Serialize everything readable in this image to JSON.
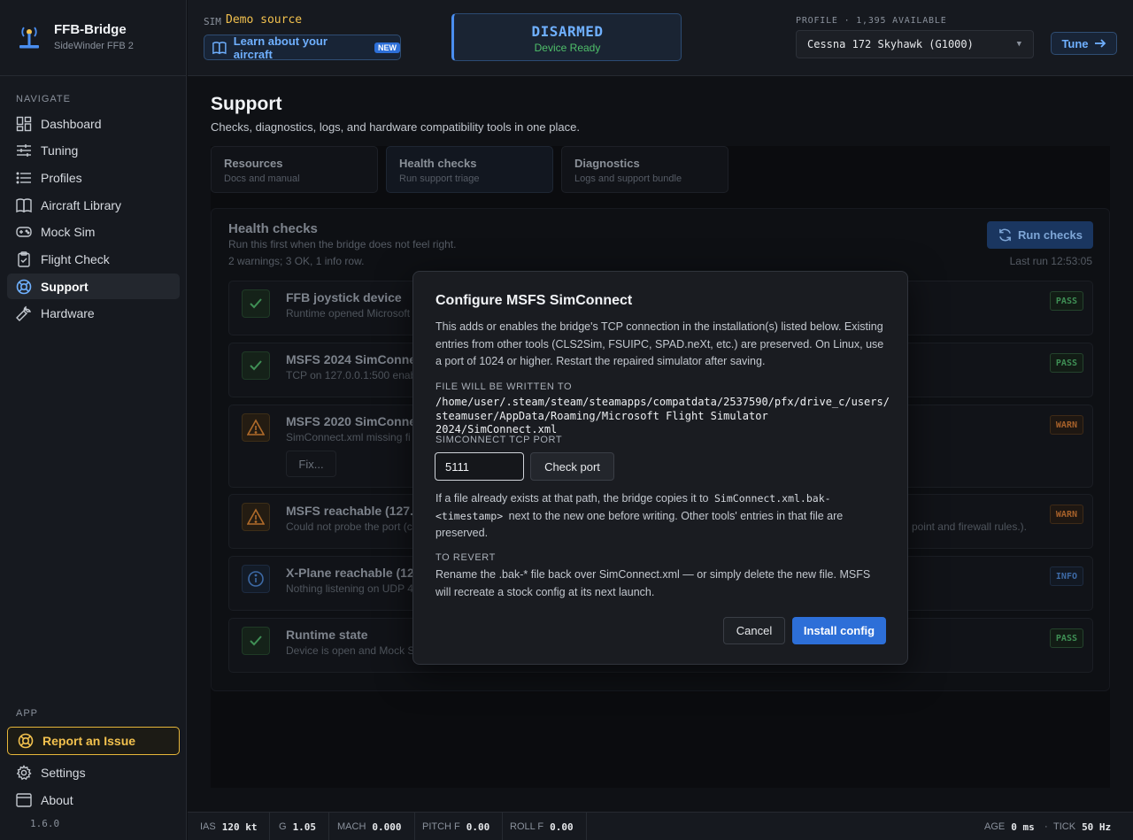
{
  "brand": {
    "name": "FFB-Bridge",
    "subtitle": "SideWinder FFB 2"
  },
  "sidebar": {
    "navigate_label": "NAVIGATE",
    "items": [
      {
        "label": "Dashboard",
        "icon": "grid-icon"
      },
      {
        "label": "Tuning",
        "icon": "sliders-icon"
      },
      {
        "label": "Profiles",
        "icon": "list-icon"
      },
      {
        "label": "Aircraft Library",
        "icon": "book-icon"
      },
      {
        "label": "Mock Sim",
        "icon": "gamepad-icon"
      },
      {
        "label": "Flight Check",
        "icon": "clipboard-check-icon"
      },
      {
        "label": "Support",
        "icon": "lifebuoy-icon",
        "active": true
      },
      {
        "label": "Hardware",
        "icon": "wrench-icon"
      }
    ],
    "app_label": "APP",
    "report_label": "Report an Issue",
    "settings_label": "Settings",
    "about_label": "About",
    "version": "1.6.0"
  },
  "topbar": {
    "sim_label": "SIM",
    "sim_value": "Demo source",
    "learn_label": "Learn about your aircraft",
    "new_badge": "NEW",
    "status_title": "DISARMED",
    "status_sub": "Device Ready",
    "profile_label": "PROFILE · 1,395 AVAILABLE",
    "profile_value": "Cessna 172 Skyhawk (G1000)",
    "tune_label": "Tune"
  },
  "page": {
    "title": "Support",
    "subtitle": "Checks, diagnostics, logs, and hardware compatibility tools in one place.",
    "tabs": [
      {
        "title": "Resources",
        "sub": "Docs and manual"
      },
      {
        "title": "Health checks",
        "sub": "Run support triage"
      },
      {
        "title": "Diagnostics",
        "sub": "Logs and support bundle"
      }
    ]
  },
  "health": {
    "title": "Health checks",
    "description": "Run this first when the bridge does not feel right.",
    "summary": "2 warnings; 3 OK, 1 info row.",
    "run_label": "Run checks",
    "last_run": "Last run 12:53:05",
    "rows": [
      {
        "name": "FFB joystick device",
        "detail": "Runtime opened Microsoft",
        "detail_right": "",
        "status": "PASS",
        "kind": "pass"
      },
      {
        "name": "MSFS 2024 SimConnect",
        "detail": "TCP on 127.0.0.1:500 enabl",
        "detail_right": "",
        "status": "PASS",
        "kind": "pass"
      },
      {
        "name": "MSFS 2020 SimConnect",
        "detail": "SimConnect.xml missing fi",
        "detail_right": "",
        "status": "WARN",
        "kind": "warn",
        "fix_label": "Fix..."
      },
      {
        "name": "MSFS reachable (127.0.",
        "detail": "Could not probe the port (c",
        "detail_right": "point and firewall rules.).",
        "status": "WARN",
        "kind": "warn"
      },
      {
        "name": "X-Plane reachable (127",
        "detail": "Nothing listening on UDP 4",
        "detail_right": "",
        "status": "INFO",
        "kind": "info"
      },
      {
        "name": "Runtime state",
        "detail": "Device is open and Mock S",
        "detail_right": "",
        "status": "PASS",
        "kind": "pass"
      }
    ]
  },
  "modal": {
    "title": "Configure MSFS SimConnect",
    "intro": "This adds or enables the bridge's TCP connection in the installation(s) listed below. Existing entries from other tools (CLS2Sim, FSUIPC, SPAD.neXt, etc.) are preserved. On Linux, use a port of 1024 or higher. Restart the repaired simulator after saving.",
    "file_label": "FILE WILL BE WRITTEN TO",
    "file_path_line1": "/home/user/.steam/steam/steamapps/compatdata/2537590/pfx/drive_c/users/",
    "file_path_line2": "steamuser/AppData/Roaming/Microsoft Flight Simulator 2024/SimConnect.xml",
    "port_label": "SIMCONNECT TCP PORT",
    "port_value": "5111",
    "check_port_label": "Check port",
    "copy_note_a": "If a file already exists at that path, the bridge copies it to",
    "copy_note_code1": "SimConnect.xml.bak-<timestamp>",
    "copy_note_b": "next to the new one before writing. Other tools' entries in that file are preserved.",
    "revert_label": "TO REVERT",
    "revert_text": "Rename the .bak-* file back over SimConnect.xml — or simply delete the new file. MSFS will recreate a stock config at its next launch.",
    "cancel_label": "Cancel",
    "install_label": "Install config"
  },
  "telemetry": {
    "ias_label": "IAS",
    "ias_value": "120 kt",
    "g_label": "G",
    "g_value": "1.05",
    "mach_label": "MACH",
    "mach_value": "0.000",
    "pitch_label": "PITCH F",
    "pitch_value": "0.00",
    "roll_label": "ROLL F",
    "roll_value": "0.00",
    "age_label": "AGE",
    "age_value": "0 ms",
    "tick_label": "TICK",
    "tick_value": "50 Hz"
  },
  "colors": {
    "accent": "#2d6fd8",
    "warn": "#f2c14e",
    "pass": "#4fbf6a"
  }
}
